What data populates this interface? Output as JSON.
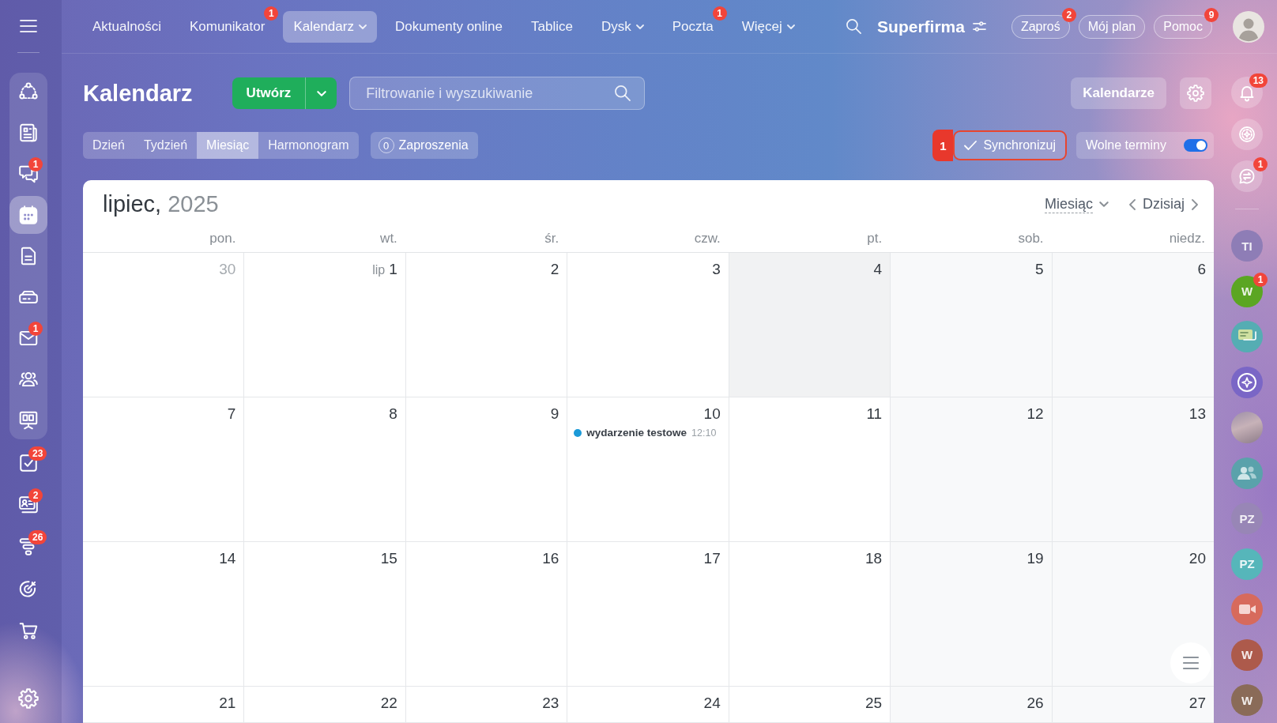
{
  "top_bar": {
    "nav": [
      {
        "label": "Aktualności",
        "dropdown": false,
        "selected": false
      },
      {
        "label": "Komunikator",
        "badge": "1",
        "dropdown": false,
        "selected": false
      },
      {
        "label": "Kalendarz",
        "dropdown": true,
        "selected": true
      },
      {
        "label": "Dokumenty online",
        "dropdown": false,
        "selected": false
      },
      {
        "label": "Tablice",
        "dropdown": false,
        "selected": false
      },
      {
        "label": "Dysk",
        "dropdown": true,
        "selected": false
      },
      {
        "label": "Poczta",
        "badge": "1",
        "dropdown": false,
        "selected": false
      },
      {
        "label": "Więcej",
        "dropdown": true,
        "selected": false
      }
    ],
    "company": "Superfirma",
    "buttons": [
      {
        "label": "Zaproś",
        "badge": "2"
      },
      {
        "label": "Mój plan"
      },
      {
        "label": "Pomoc",
        "badge": "9"
      }
    ]
  },
  "left_sidebar": {
    "group_items": [
      {
        "selected": false
      },
      {
        "selected": false
      },
      {
        "badge": "1",
        "selected": false
      },
      {
        "selected": true
      },
      {
        "selected": false
      },
      {
        "selected": false
      },
      {
        "badge": "1",
        "selected": false
      },
      {
        "selected": false
      },
      {
        "selected": false
      }
    ],
    "items": [
      {
        "badge": "23",
        "selected": false
      },
      {
        "badge": "2",
        "selected": false
      },
      {
        "badge": "26",
        "selected": false
      },
      {
        "selected": false
      },
      {
        "selected": false
      }
    ]
  },
  "page": {
    "title": "Kalendarz",
    "create_button": "Utwórz",
    "search": {
      "placeholder": "Filtrowanie i wyszukiwanie"
    },
    "calendars_button": "Kalendarze",
    "view_tabs": [
      {
        "label": "Dzień",
        "selected": false
      },
      {
        "label": "Tydzień",
        "selected": false
      },
      {
        "label": "Miesiąc",
        "selected": true
      },
      {
        "label": "Harmonogram",
        "selected": false
      }
    ],
    "invitations": {
      "count": "0",
      "label": "Zaproszenia"
    },
    "sync": {
      "error_count": "1",
      "label": "Synchronizuj",
      "error": true
    },
    "free_slots": {
      "label": "Wolne terminy",
      "on": true
    }
  },
  "calendar": {
    "month": "lipiec,",
    "year": "2025",
    "view_select": "Miesiąc",
    "today_button": "Dzisiaj",
    "weekdays": [
      "pon.",
      "wt.",
      "śr.",
      "czw.",
      "pt.",
      "sob.",
      "niedz."
    ],
    "weeks": [
      [
        {
          "number": "30",
          "kind": "other-month"
        },
        {
          "month_prefix": "lip",
          "number": "1",
          "kind": "workday"
        },
        {
          "number": "2",
          "kind": "workday"
        },
        {
          "number": "3",
          "kind": "workday"
        },
        {
          "number": "4",
          "kind": "day-off"
        },
        {
          "number": "5",
          "kind": "weekend"
        },
        {
          "number": "6",
          "kind": "weekend"
        }
      ],
      [
        {
          "number": "7",
          "kind": "workday"
        },
        {
          "number": "8",
          "kind": "workday"
        },
        {
          "number": "9",
          "kind": "workday"
        },
        {
          "number": "10",
          "kind": "workday",
          "events": [
            {
              "title": "wydarzenie testowe",
              "time": "12:10",
              "color": "#1b9ad8"
            }
          ]
        },
        {
          "number": "11",
          "kind": "workday"
        },
        {
          "number": "12",
          "kind": "weekend"
        },
        {
          "number": "13",
          "kind": "weekend"
        }
      ],
      [
        {
          "number": "14",
          "kind": "workday"
        },
        {
          "number": "15",
          "kind": "workday"
        },
        {
          "number": "16",
          "kind": "workday"
        },
        {
          "number": "17",
          "kind": "workday"
        },
        {
          "number": "18",
          "kind": "workday"
        },
        {
          "number": "19",
          "kind": "weekend"
        },
        {
          "number": "20",
          "kind": "weekend"
        }
      ],
      [
        {
          "number": "21",
          "kind": "workday"
        },
        {
          "number": "22",
          "kind": "workday"
        },
        {
          "number": "23",
          "kind": "workday"
        },
        {
          "number": "24",
          "kind": "workday"
        },
        {
          "number": "25",
          "kind": "workday"
        },
        {
          "number": "26",
          "kind": "weekend"
        },
        {
          "number": "27",
          "kind": "weekend"
        }
      ]
    ]
  },
  "right_sidebar": {
    "tools": [
      {
        "kind": "bell",
        "badge": "13"
      },
      {
        "kind": "sparkle"
      },
      {
        "kind": "chat-arrows",
        "badge": "1"
      }
    ],
    "chats": [
      {
        "kind": "initials",
        "initials": "TI",
        "color": "#8e7db6"
      },
      {
        "kind": "initials",
        "initials": "W",
        "color": "#5ba622",
        "badge": "1"
      },
      {
        "kind": "chat-image",
        "color": "#55adb3"
      },
      {
        "kind": "sparkle",
        "color": "#7a66c6"
      },
      {
        "kind": "photo"
      },
      {
        "kind": "group",
        "color": "#5aa2ab"
      },
      {
        "kind": "initials",
        "initials": "PZ",
        "color": "#9886b6"
      },
      {
        "kind": "initials",
        "initials": "PZ",
        "color": "#56b6ba"
      },
      {
        "kind": "video",
        "color": "#d76a5c"
      },
      {
        "kind": "initials",
        "initials": "W",
        "color": "#ad5a4b"
      },
      {
        "kind": "initials",
        "initials": "W",
        "color": "#8a6b58"
      }
    ]
  }
}
